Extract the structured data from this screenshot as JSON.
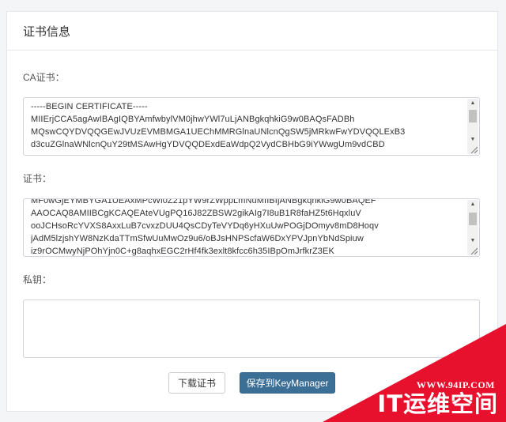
{
  "panel": {
    "title": "证书信息"
  },
  "ca_cert": {
    "label": "CA证书：",
    "lines": [
      "-----BEGIN CERTIFICATE-----",
      "MIIErjCCA5agAwIBAgIQBYAmfwbylVM0jhwYWl7uLjANBgkqhkiG9w0BAQsFADBh",
      "MQswCQYDVQQGEwJVUzEVMBMGA1UEChMMRGlnaUNlcnQgSW5jMRkwFwYDVQQLExB3",
      "d3cuZGlnaWNlcnQuY29tMSAwHgYDVQQDExdEaWdpQ2VydCBHbG9iYWwgUm9vdCBD"
    ]
  },
  "cert": {
    "label": "证书：",
    "lines": [
      "MF0wGjEYMBYGA1UEAxMPcWl0Z21pYW9rZWppLmNuMIIBIjANBgkqhkiG9w0BAQEF",
      "AAOCAQ8AMIIBCgKCAQEAteVUgPQ16J82ZBSW2gikAIg7I8uB1R8faHZ5t6HqxluV",
      "ooJCHsoRcYVXS8AxxLuB7cvxzDUU4QsCDyTeVYDq6yHXuUwPOGjDOmyv8mD8Hoqv",
      "jAdM5lzjshYW8NzKdaTTmSfwUuMwOz9u6/oBJsHNPScfaW6DxYPVJpnYbNdSpiuw",
      "iz9rOCMwyNjPOhYjn0C+g8aqhxEGC2rHf4fk3exlt8kfcc6h35IBpOmJrfkrZ3EK"
    ]
  },
  "private_key": {
    "label": "私钥：",
    "value": ""
  },
  "actions": {
    "download_label": "下载证书",
    "save_label": "保存到KeyManager"
  },
  "watermark": {
    "url": "WWW.94IP.COM",
    "brand": "IT运维空间"
  },
  "colors": {
    "primary": "#3c6f96",
    "watermark": "#e8112d"
  }
}
